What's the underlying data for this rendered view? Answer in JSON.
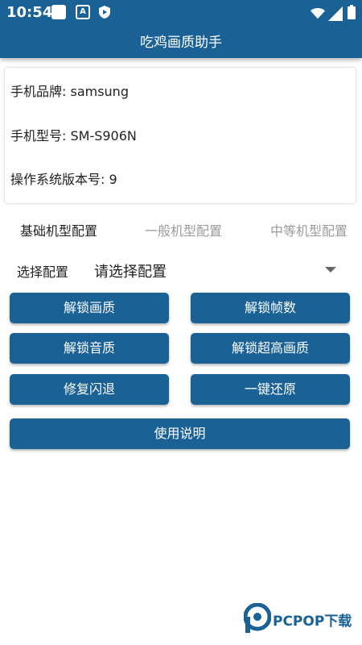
{
  "status_bar": {
    "time": "10:54",
    "icons": [
      "square-notification-icon",
      "a-icon",
      "shield-play-icon",
      "wifi-icon",
      "signal-icon",
      "battery-icon"
    ],
    "a_letter": "A"
  },
  "app_bar": {
    "title": "吃鸡画质助手"
  },
  "device_info": {
    "brand": "手机品牌: samsung",
    "model": "手机型号: SM-S906N",
    "os_version": "操作系统版本号: 9"
  },
  "tabs": [
    {
      "label": "基础机型配置",
      "selected": true
    },
    {
      "label": "一般机型配置",
      "selected": false
    },
    {
      "label": "中等机型配置",
      "selected": false
    }
  ],
  "config_select": {
    "label": "选择配置",
    "value": "请选择配置"
  },
  "buttons": {
    "unlock_quality": "解锁画质",
    "unlock_fps": "解锁帧数",
    "unlock_audio": "解锁音质",
    "unlock_ultra": "解锁超高画质",
    "fix_crash": "修复闪退",
    "restore": "一键还原",
    "instructions": "使用说明"
  },
  "watermark": {
    "text": "PCPOP下载"
  },
  "colors": {
    "primary": "#1a6296",
    "tab_inactive": "#9b9b9b",
    "text": "#222222",
    "background": "#ffffff"
  }
}
